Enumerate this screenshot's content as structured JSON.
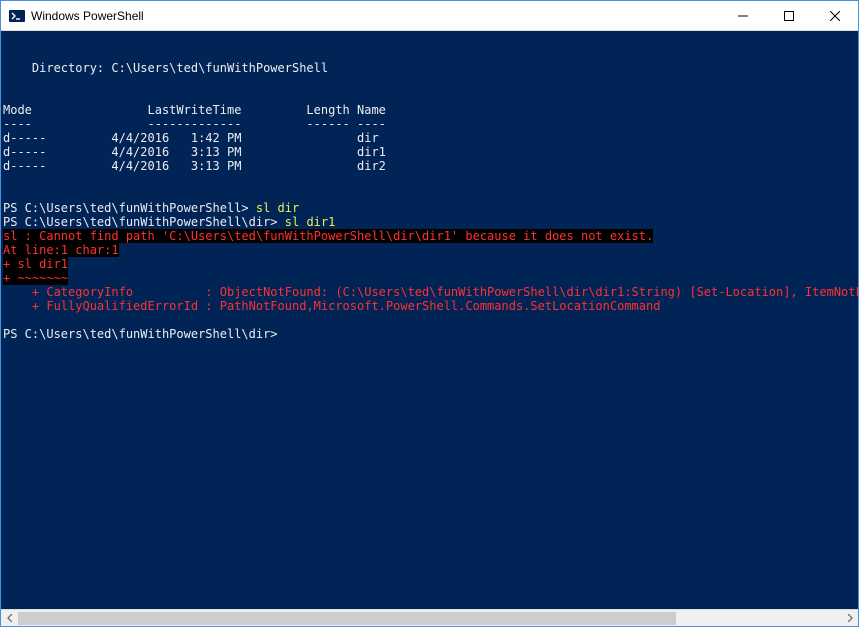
{
  "window": {
    "title": "Windows PowerShell"
  },
  "terminal": {
    "blank1": "",
    "dir_header": "    Directory: C:\\Users\\ted\\funWithPowerShell",
    "blank2": "",
    "blank3": "",
    "col_header": "Mode                LastWriteTime         Length Name",
    "col_sep": "----                -------------         ------ ----",
    "row1": "d-----         4/4/2016   1:42 PM                dir",
    "row2": "d-----         4/4/2016   3:13 PM                dir1",
    "row3": "d-----         4/4/2016   3:13 PM                dir2",
    "blank4": "",
    "blank5": "",
    "prompt1_prefix": "PS C:\\Users\\ted\\funWithPowerShell> ",
    "prompt1_cmd": "sl dir",
    "prompt2_prefix": "PS C:\\Users\\ted\\funWithPowerShell\\dir> ",
    "prompt2_cmd": "sl dir1",
    "err_line1": "sl : Cannot find path 'C:\\Users\\ted\\funWithPowerShell\\dir\\dir1' because it does not exist.",
    "err_line2": "At line:1 char:1",
    "err_line3": "+ sl dir1",
    "err_line4": "+ ~~~~~~~",
    "err_line5": "    + CategoryInfo          : ObjectNotFound: (C:\\Users\\ted\\funWithPowerShell\\dir\\dir1:String) [Set-Location], ItemNotFo",
    "err_line6": "    + FullyQualifiedErrorId : PathNotFound,Microsoft.PowerShell.Commands.SetLocationCommand",
    "blank6": "",
    "prompt3_prefix": "PS C:\\Users\\ted\\funWithPowerShell\\dir>",
    "prompt3_cmd": " "
  }
}
